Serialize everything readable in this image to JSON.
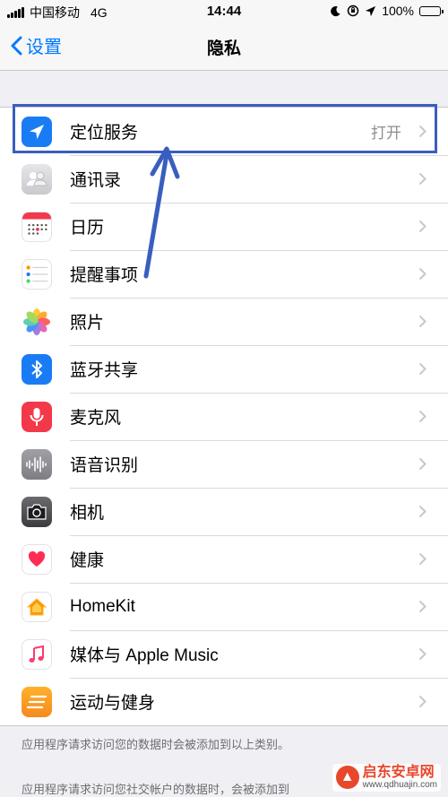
{
  "status": {
    "carrier": "中国移动",
    "network": "4G",
    "time": "14:44",
    "battery": "100%",
    "battery_level": 1.0
  },
  "nav": {
    "back_label": "设置",
    "title": "隐私"
  },
  "items": [
    {
      "label": "定位服务",
      "value": "打开",
      "icon": "location-arrow-icon",
      "color": "#1a7cf5"
    },
    {
      "label": "通讯录",
      "icon": "contacts-icon",
      "color": "#d8d8dc"
    },
    {
      "label": "日历",
      "icon": "calendar-icon",
      "color": "#ffffff"
    },
    {
      "label": "提醒事项",
      "icon": "reminders-icon",
      "color": "#ffffff"
    },
    {
      "label": "照片",
      "icon": "photos-icon",
      "color": "#ffffff"
    },
    {
      "label": "蓝牙共享",
      "icon": "bluetooth-icon",
      "color": "#1a7cf5"
    },
    {
      "label": "麦克风",
      "icon": "microphone-icon",
      "color": "#f2394a"
    },
    {
      "label": "语音识别",
      "icon": "waveform-icon",
      "color": "#8e8e93"
    },
    {
      "label": "相机",
      "icon": "camera-icon",
      "color": "#4a4a4e"
    },
    {
      "label": "健康",
      "icon": "heart-icon",
      "color": "#ffffff"
    },
    {
      "label": "HomeKit",
      "icon": "home-icon",
      "color": "#ffffff"
    },
    {
      "label": "媒体与 Apple Music",
      "icon": "music-note-icon",
      "color": "#ffffff"
    },
    {
      "label": "运动与健身",
      "icon": "fitness-icon",
      "color": "#f7a21b"
    }
  ],
  "footer": {
    "note1": "应用程序请求访问您的数据时会被添加到以上类别。",
    "note2": "应用程序请求访问您社交帐户的数据时，会被添加到"
  },
  "watermark": {
    "name": "启东安卓网",
    "url": "www.qdhuajin.com"
  }
}
